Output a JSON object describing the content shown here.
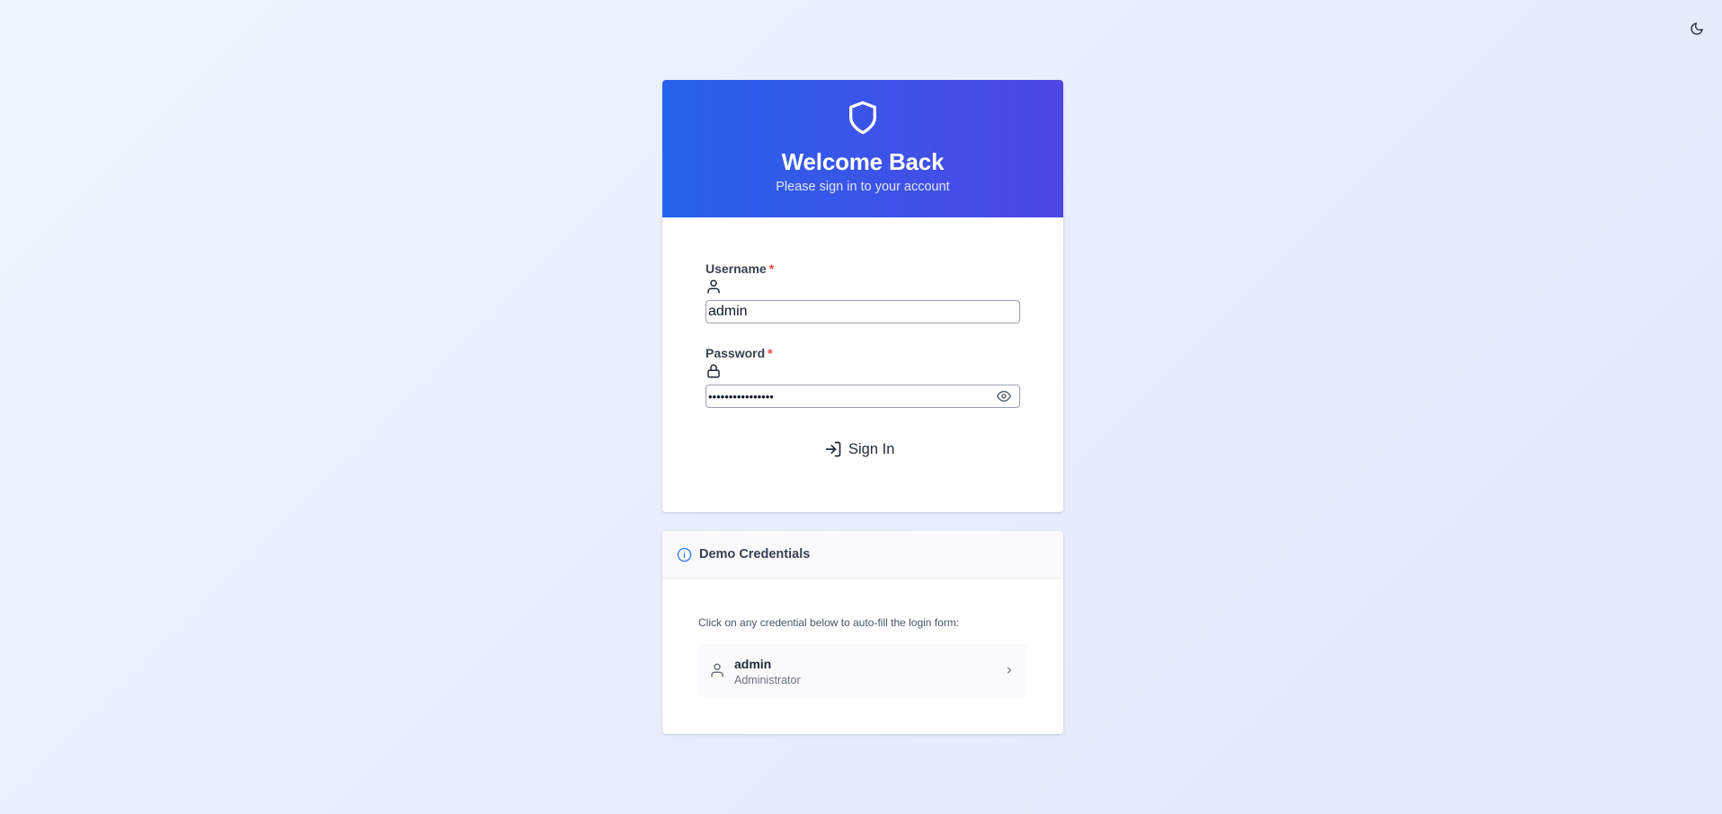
{
  "theme_toggle": {
    "icon": "moon-icon"
  },
  "login": {
    "header_icon": "shield-icon",
    "title": "Welcome Back",
    "subtitle": "Please sign in to your account",
    "username": {
      "label": "Username",
      "required_marker": "*",
      "icon": "user-icon",
      "value": "admin"
    },
    "password": {
      "label": "Password",
      "required_marker": "*",
      "icon": "lock-icon",
      "value": "••••••••••••••••",
      "toggle_icon": "eye-icon"
    },
    "submit": {
      "label": "Sign In",
      "icon": "log-in-icon"
    }
  },
  "demo": {
    "icon": "info-icon",
    "title": "Demo Credentials",
    "hint": "Click on any credential below to auto-fill the login form:",
    "credentials": [
      {
        "username": "admin",
        "role": "Administrator",
        "icon": "user-icon"
      }
    ]
  },
  "colors": {
    "header_gradient_start": "#2563eb",
    "header_gradient_end": "#4f46e5",
    "required": "#ef4444",
    "info_accent": "#3b82f6"
  }
}
